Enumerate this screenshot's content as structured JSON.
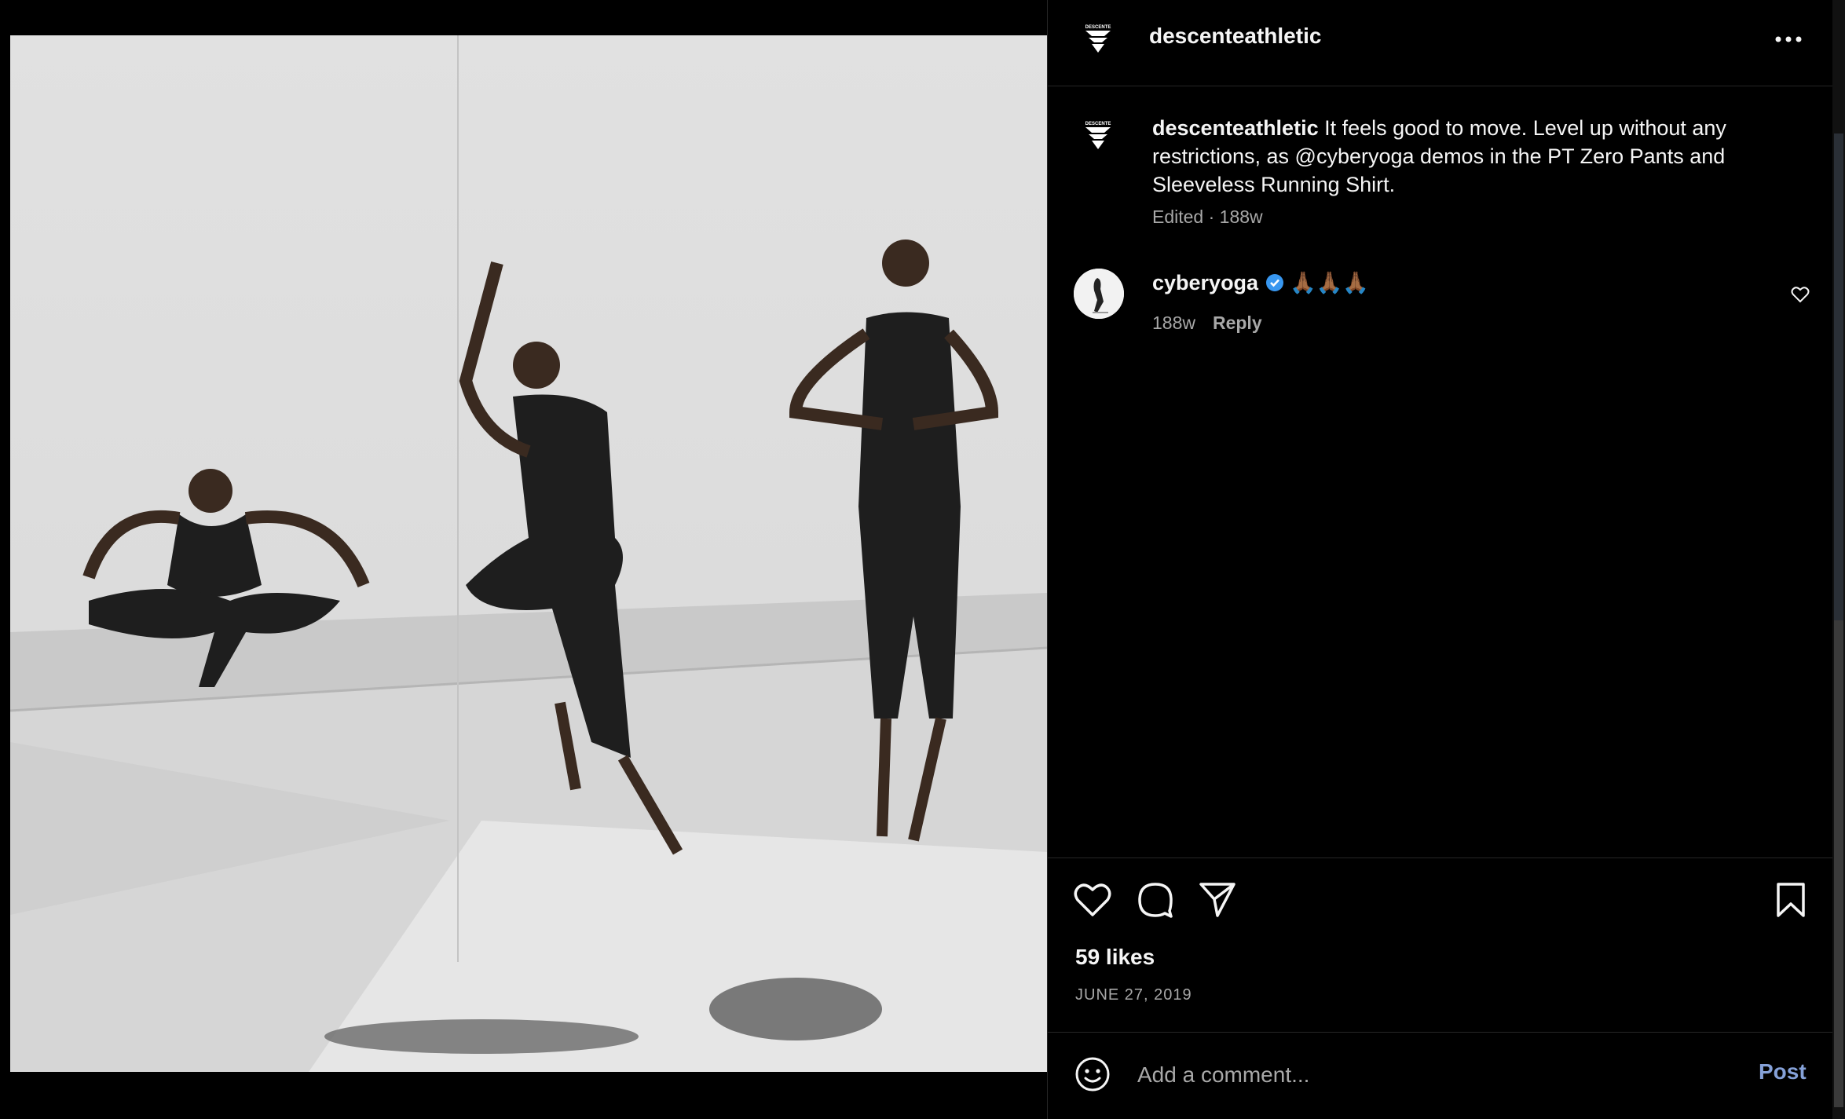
{
  "post": {
    "username": "descenteathletic",
    "logo_text": "DESCENTE",
    "more_icon": "more-horizontal-icon",
    "caption": {
      "username": "descenteathletic",
      "text": "It feels good to move. Level up without any restrictions, as @cyberyoga demos in the PT Zero Pants and Sleeveless Running Shirt.",
      "meta": "Edited · 188w"
    },
    "comments": [
      {
        "username": "cyberyoga",
        "verified": true,
        "text": "🙏🏾🙏🏾🙏🏾",
        "time": "188w",
        "reply_label": "Reply"
      }
    ],
    "likes": "59 likes",
    "date": "JUNE 27, 2019",
    "add_comment_placeholder": "Add a comment...",
    "post_label": "Post"
  },
  "colors": {
    "background": "#000000",
    "text": "#f5f5f5",
    "muted": "#a8a8a8",
    "link": "#85a1d8",
    "verified": "#3897f0"
  }
}
